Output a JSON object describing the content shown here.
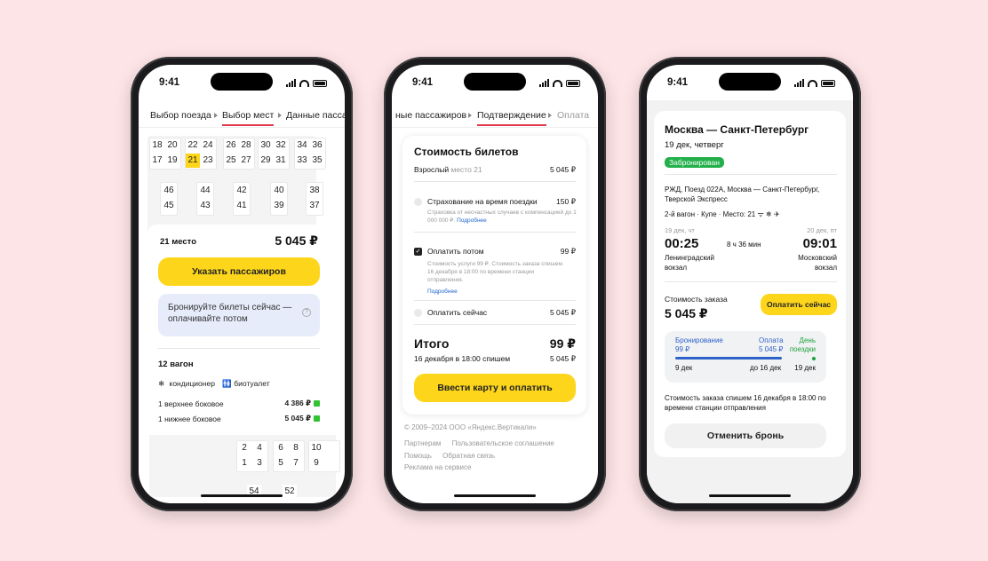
{
  "status_time": "9:41",
  "phone1": {
    "tabs": [
      "Выбор поезда",
      "Выбор мест",
      "Данные пасса"
    ],
    "seat_rows_top": [
      [
        "18",
        "22",
        "26",
        "30",
        "34"
      ],
      [
        "20",
        "24",
        "28",
        "32",
        "36"
      ],
      [
        "17",
        "21",
        "25",
        "29",
        "33"
      ],
      [
        "19",
        "23",
        "27",
        "31",
        "35"
      ]
    ],
    "seats_top_a": [
      "18",
      "20",
      "22",
      "24",
      "26",
      "28",
      "30",
      "32",
      "34",
      "36"
    ],
    "seats_top_b": [
      "17",
      "19",
      "21",
      "23",
      "25",
      "27",
      "29",
      "31",
      "33",
      "35"
    ],
    "selected_seat": "21",
    "seats_mid_a": [
      "46",
      "44",
      "42",
      "40",
      "38"
    ],
    "seats_mid_b": [
      "45",
      "43",
      "41",
      "39",
      "37"
    ],
    "seat_label": "21 место",
    "price": "5 045 ₽",
    "cta": "Указать пассажиров",
    "info": "Бронируйте билеты сейчас — оплачивайте потом",
    "info_icon": "?",
    "wagon": "12 вагон",
    "amenity1": "кондиционер",
    "amenity2": "биотуалет",
    "row1_label": "1 верхнее боковое",
    "row1_price": "4 386 ₽",
    "row2_label": "1 нижнее боковое",
    "row2_price": "5 045 ₽",
    "seats_bottom_a": [
      "2",
      "4",
      "6",
      "8",
      "10"
    ],
    "seats_bottom_b": [
      "1",
      "3",
      "5",
      "7",
      "9"
    ],
    "seats_bottom_c": [
      "54",
      "52"
    ]
  },
  "phone2": {
    "tabs": [
      "ные пассажиров",
      "Подтверждение",
      "Оплата"
    ],
    "card_title": "Стоимость билетов",
    "adult_label": "Взрослый",
    "adult_seat": "место 21",
    "adult_price": "5 045 ₽",
    "insurance_label": "Страхование на время поездки",
    "insurance_price": "150 ₽",
    "insurance_desc": "Страховка от несчастных случаев с компенсацией до 1 000 000 ₽.",
    "more": "Подробнее",
    "later_label": "Оплатить потом",
    "later_price": "99 ₽",
    "later_desc": "Стоимость услуги 99 ₽. Стоимость заказа спишем 16 декабря в 18:00 по времени станции отправления.",
    "now_label": "Оплатить сейчас",
    "now_price": "5 045 ₽",
    "total_label": "Итого",
    "total_price": "99 ₽",
    "charge_date": "16 декабря в 18:00 спишем",
    "charge_amount": "5 045 ₽",
    "cta": "Ввести карту и оплатить",
    "copyright": "© 2009–2024 ООО «Яндекс.Вертикали»",
    "links": [
      "Партнерам",
      "Пользовательское соглашение",
      "Помощь",
      "Обратная связь",
      "Реклама на сервисе"
    ]
  },
  "phone3": {
    "route": "Москва — Санкт-Петербург",
    "date": "19 дек, четверг",
    "status_badge": "Забронирован",
    "train_info": "РЖД, Поезд 022А, Москва — Санкт-Петербург, Тверской Экспресс",
    "car_info": "2-й вагон · Купе · Место: 21",
    "dep_date": "19 дек, чт",
    "arr_date": "20 дек, пт",
    "dep_time": "00:25",
    "duration": "8 ч 36 мин",
    "arr_time": "09:01",
    "dep_station": "Ленинградский вокзал",
    "arr_station": "Московский вокзал",
    "order_cost_label": "Стоимость заказа",
    "order_cost": "5 045 ₽",
    "pay_now": "Оплатить сейчас",
    "tl_booking": "Бронирование",
    "tl_booking_amt": "99 ₽",
    "tl_pay": "Оплата",
    "tl_pay_amt": "5 045 ₽",
    "tl_trip": "День поездки",
    "tl_d1": "9 дек",
    "tl_d2": "до 16 дек",
    "tl_d3": "19 дек",
    "note": "Стоимость заказа спишем 16 декабря в 18:00 по времени станции отправления",
    "cancel": "Отменить бронь"
  }
}
